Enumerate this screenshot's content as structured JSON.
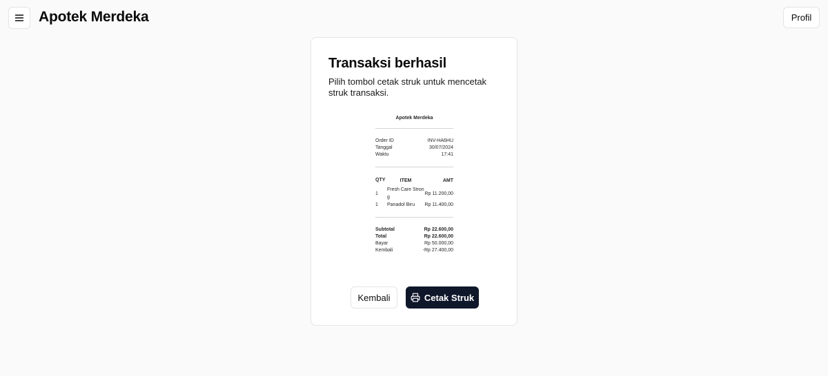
{
  "header": {
    "menu_icon": "menu-icon",
    "title": "Apotek Merdeka",
    "profile_label": "Profil"
  },
  "card": {
    "title": "Transaksi berhasil",
    "description": "Pilih tombol cetak struk untuk mencetak struk transaksi."
  },
  "receipt": {
    "store_name": "Apotek Merdeka",
    "order_id_label": "Order ID",
    "order_id_value": "INV-HA6HU",
    "date_label": "Tanggal",
    "date_value": "30/07/2024",
    "time_label": "Waktu",
    "time_value": "17:41",
    "headers": {
      "qty": "QTY",
      "item": "ITEM",
      "amt": "AMT"
    },
    "items": [
      {
        "qty": "1",
        "item": "Fresh Care Strong",
        "amt": "Rp 11.200,00"
      },
      {
        "qty": "1",
        "item": "Panadol Biru",
        "amt": "Rp 11.400,00"
      }
    ],
    "subtotal_label": "Subtotal",
    "subtotal_value": "Rp 22.600,00",
    "total_label": "Total",
    "total_value": "Rp 22.600,00",
    "paid_label": "Bayar",
    "paid_value": "Rp 50.000,00",
    "change_label": "Kembali",
    "change_value": "-Rp 27.400,00"
  },
  "actions": {
    "back_label": "Kembali",
    "print_label": "Cetak Struk",
    "print_icon": "printer-icon"
  }
}
